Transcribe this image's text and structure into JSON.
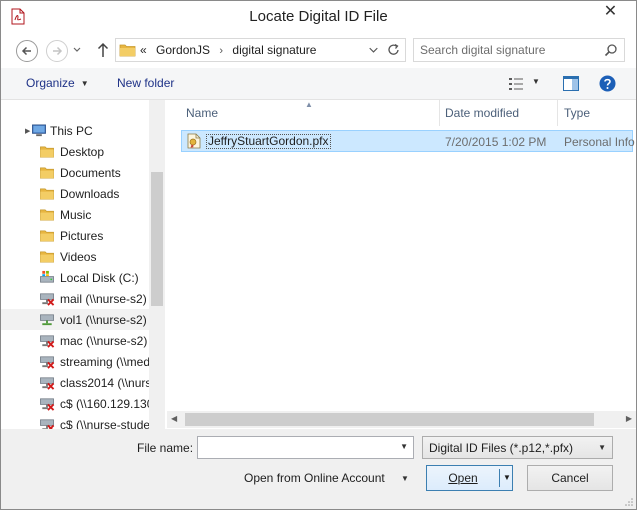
{
  "window": {
    "title": "Locate Digital ID File",
    "close_glyph": "✕",
    "icon": "pdf-file-icon"
  },
  "address": {
    "back_icon": "back-arrow-icon",
    "forward_icon": "forward-arrow-icon",
    "up_icon": "up-arrow-icon",
    "overflow": "«",
    "crumbs": [
      "GordonJS",
      "digital signature"
    ],
    "crumb_separator": "›",
    "refresh_icon": "refresh-icon"
  },
  "search": {
    "placeholder": "Search digital signature",
    "icon": "search-icon"
  },
  "toolbar": {
    "organize_label": "Organize",
    "new_folder_label": "New folder",
    "view_icon": "view-options-icon",
    "preview_icon": "preview-pane-icon",
    "help_icon": "help-icon"
  },
  "nav": {
    "items": [
      {
        "label": "This PC",
        "icon": "computer-icon",
        "level": 0,
        "state": ""
      },
      {
        "label": "Desktop",
        "icon": "folder-icon",
        "level": 1,
        "state": ""
      },
      {
        "label": "Documents",
        "icon": "folder-icon",
        "level": 1,
        "state": ""
      },
      {
        "label": "Downloads",
        "icon": "folder-icon",
        "level": 1,
        "state": ""
      },
      {
        "label": "Music",
        "icon": "folder-icon",
        "level": 1,
        "state": ""
      },
      {
        "label": "Pictures",
        "icon": "folder-icon",
        "level": 1,
        "state": ""
      },
      {
        "label": "Videos",
        "icon": "folder-icon",
        "level": 1,
        "state": ""
      },
      {
        "label": "Local Disk (C:)",
        "icon": "local-disk-icon",
        "level": 1,
        "state": ""
      },
      {
        "label": "mail (\\\\nurse-s2)",
        "icon": "disconnected-drive-icon",
        "level": 1,
        "state": ""
      },
      {
        "label": "vol1 (\\\\nurse-s2)",
        "icon": "network-drive-icon",
        "level": 1,
        "state": "hovered"
      },
      {
        "label": "mac (\\\\nurse-s2)",
        "icon": "disconnected-drive-icon",
        "level": 1,
        "state": ""
      },
      {
        "label": "streaming (\\\\med",
        "icon": "disconnected-drive-icon",
        "level": 1,
        "state": ""
      },
      {
        "label": "class2014 (\\\\nurs",
        "icon": "disconnected-drive-icon",
        "level": 1,
        "state": ""
      },
      {
        "label": "c$ (\\\\160.129.130",
        "icon": "disconnected-drive-icon",
        "level": 1,
        "state": ""
      },
      {
        "label": "c$ (\\\\nurse-stude",
        "icon": "disconnected-drive-icon",
        "level": 1,
        "state": ""
      }
    ]
  },
  "files": {
    "columns": {
      "name": "Name",
      "date": "Date modified",
      "type": "Type"
    },
    "rows": [
      {
        "name": "JeffryStuartGordon.pfx",
        "date": "7/20/2015 1:02 PM",
        "type": "Personal Info",
        "icon": "certificate-file-icon"
      }
    ]
  },
  "bottom": {
    "file_name_label": "File name:",
    "file_name_value": "",
    "filter_value": "Digital ID Files (*.p12,*.pfx)",
    "online_label": "Open from Online Account",
    "open_label": "Open",
    "cancel_label": "Cancel"
  },
  "colors": {
    "selection": "#cce8ff",
    "selection_border": "#99d1ff",
    "link": "#1e3287",
    "open_border": "#3c7fb1"
  }
}
